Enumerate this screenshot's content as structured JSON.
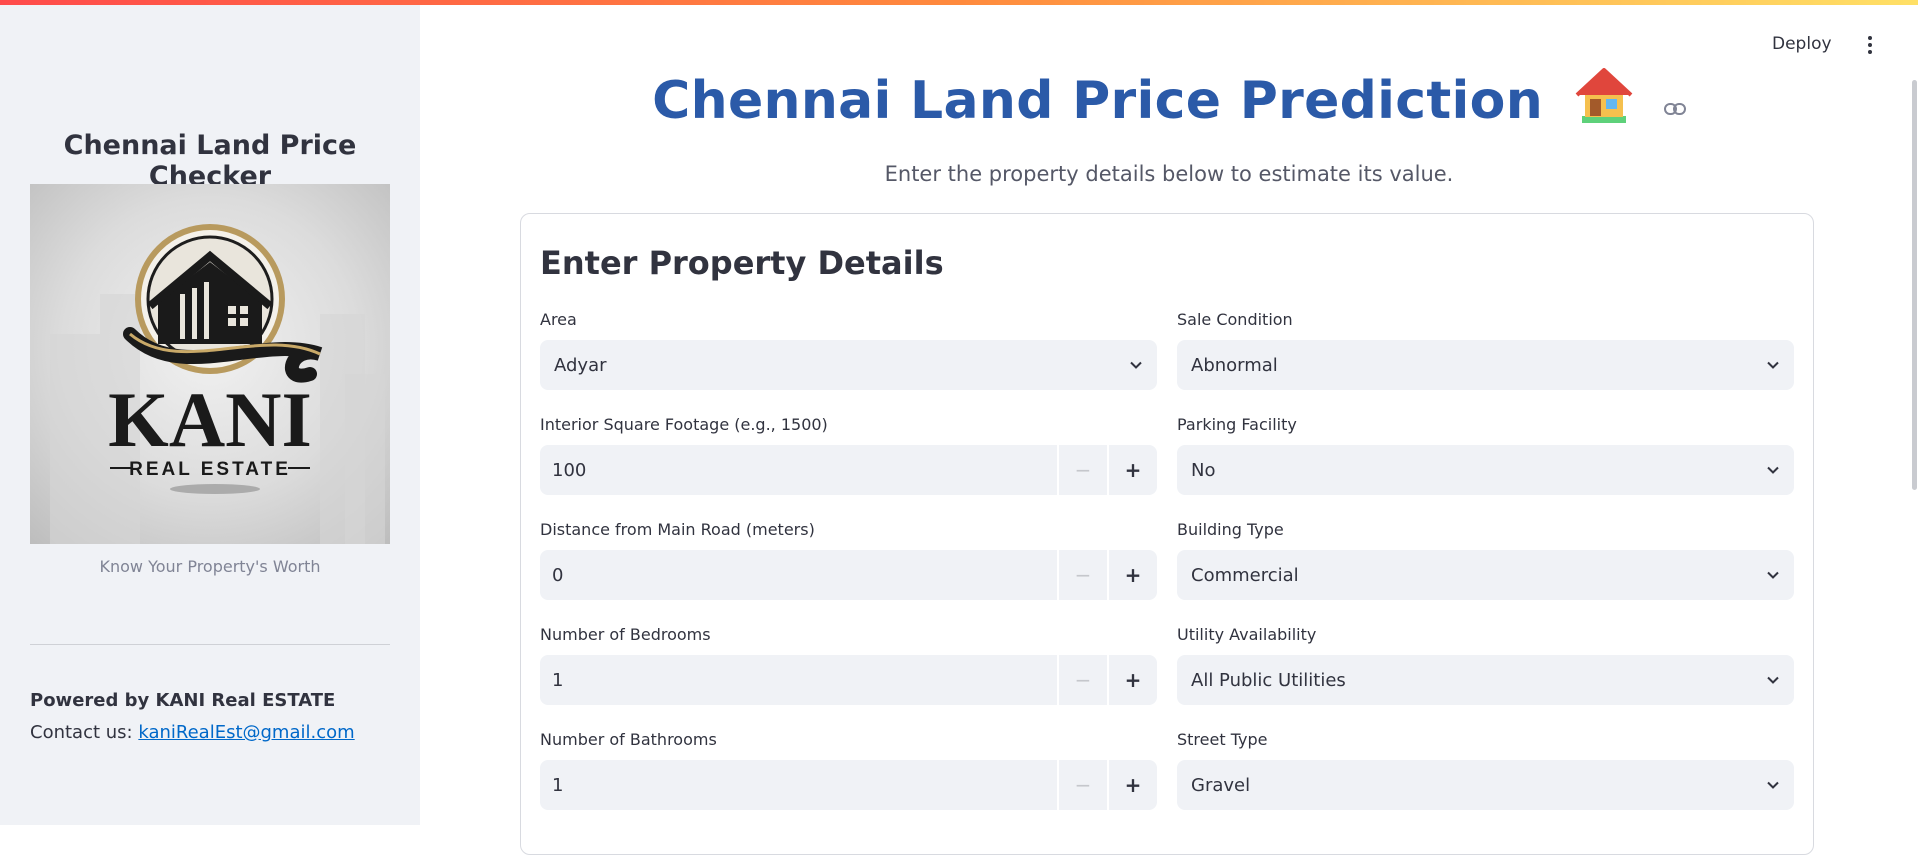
{
  "sidebar": {
    "title": "Chennai Land Price Checker",
    "logo": {
      "brand": "KANI",
      "tagline": "REAL ESTATE"
    },
    "caption": "Know Your Property's Worth",
    "powered_by": "Powered by KANI Real ESTATE",
    "contact_prefix": "Contact us:",
    "contact_email": "kaniRealEst@gmail.com"
  },
  "toolbar": {
    "deploy_label": "Deploy",
    "menu_icon": "vertical-ellipsis-icon"
  },
  "main": {
    "title": "Chennai Land Price Prediction",
    "title_emoji_icon": "house-emoji-icon",
    "subtitle": "Enter the property details below to estimate its value."
  },
  "form": {
    "title": "Enter Property Details",
    "area": {
      "label": "Area",
      "value": "Adyar"
    },
    "sale_condition": {
      "label": "Sale Condition",
      "value": "Abnormal"
    },
    "interior_sqft": {
      "label": "Interior Square Footage (e.g., 1500)",
      "value": "100"
    },
    "parking": {
      "label": "Parking Facility",
      "value": "No"
    },
    "distance": {
      "label": "Distance from Main Road (meters)",
      "value": "0"
    },
    "building_type": {
      "label": "Building Type",
      "value": "Commercial"
    },
    "bedrooms": {
      "label": "Number of Bedrooms",
      "value": "1"
    },
    "utility": {
      "label": "Utility Availability",
      "value": "All Public Utilities"
    },
    "bathrooms": {
      "label": "Number of Bathrooms",
      "value": "1"
    },
    "street_type": {
      "label": "Street Type",
      "value": "Gravel"
    },
    "stepper_minus": "−",
    "stepper_plus": "+"
  },
  "colors": {
    "title_blue": "#2b5aa8",
    "link_blue": "#0068c9",
    "sidebar_bg": "#f0f2f6"
  }
}
